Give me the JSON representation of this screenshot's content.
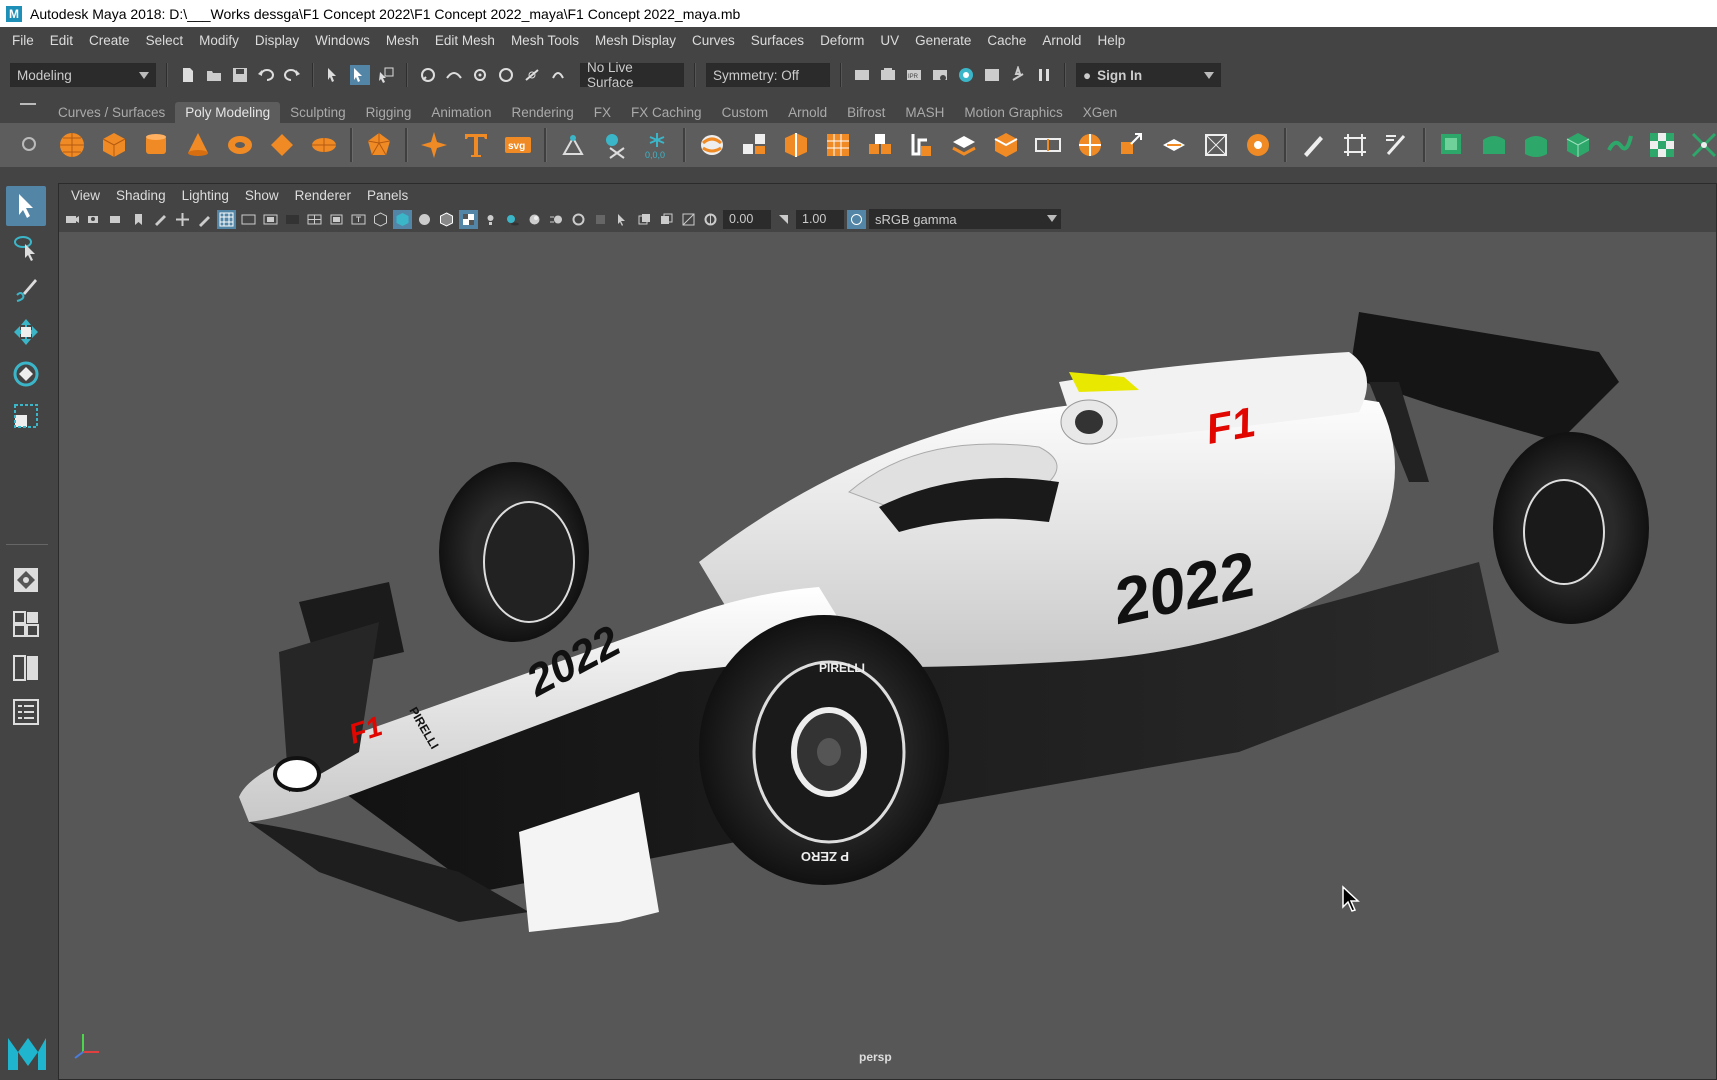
{
  "window": {
    "title": "Autodesk Maya 2018: D:\\___Works dessga\\F1 Concept 2022\\F1 Concept 2022_maya\\F1 Concept 2022_maya.mb"
  },
  "menubar": {
    "items": [
      "File",
      "Edit",
      "Create",
      "Select",
      "Modify",
      "Display",
      "Windows",
      "Mesh",
      "Edit Mesh",
      "Mesh Tools",
      "Mesh Display",
      "Curves",
      "Surfaces",
      "Deform",
      "UV",
      "Generate",
      "Cache",
      "Arnold",
      "Help"
    ]
  },
  "statusline": {
    "menuset": "Modeling",
    "live_surface": "No Live Surface",
    "symmetry": "Symmetry: Off",
    "sign_in": "Sign In"
  },
  "shelf": {
    "tabs": [
      "Curves / Surfaces",
      "Poly Modeling",
      "Sculpting",
      "Rigging",
      "Animation",
      "Rendering",
      "FX",
      "FX Caching",
      "Custom",
      "Arnold",
      "Bifrost",
      "MASH",
      "Motion Graphics",
      "XGen"
    ],
    "active_tab": "Poly Modeling",
    "svg_label": "svg",
    "coord_label": "0,0,0"
  },
  "panel": {
    "menu": [
      "View",
      "Shading",
      "Lighting",
      "Show",
      "Renderer",
      "Panels"
    ],
    "exposure": "0.00",
    "gamma": "1.00",
    "color_space": "sRGB gamma",
    "camera": "persp"
  },
  "scene": {
    "car_numbers": [
      "2022",
      "2022"
    ],
    "tyre_brand": "PIRELLI",
    "tyre_text": "P ZERO",
    "logo": "F1"
  },
  "colors": {
    "accent": "#5285a6",
    "maya_blue": "#1e8fb7",
    "viewport_bg": "#575757",
    "panel_bg": "#444444",
    "f1_red": "#e10600"
  }
}
